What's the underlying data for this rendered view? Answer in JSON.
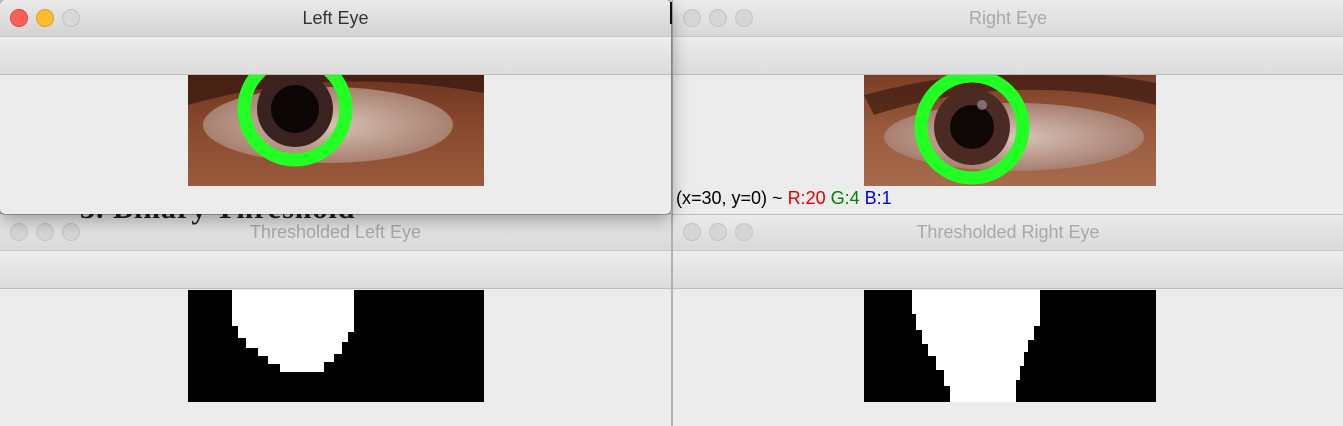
{
  "windows": {
    "left_eye": {
      "title": "Left Eye"
    },
    "right_eye": {
      "title": "Right Eye"
    },
    "thresh_left": {
      "title": "Thresholded Left Eye"
    },
    "thresh_right": {
      "title": "Thresholded Right Eye"
    }
  },
  "status": {
    "coords": "(x=30, y=0) ~ ",
    "r": "R:20",
    "g": "G:4",
    "b": "B:1"
  },
  "background_text": "3. Binary Threshold",
  "colors": {
    "circle_green": "#22ff22",
    "eye_skin": "#8a4a30",
    "threshold_white": "#ffffff",
    "threshold_black": "#000000"
  }
}
